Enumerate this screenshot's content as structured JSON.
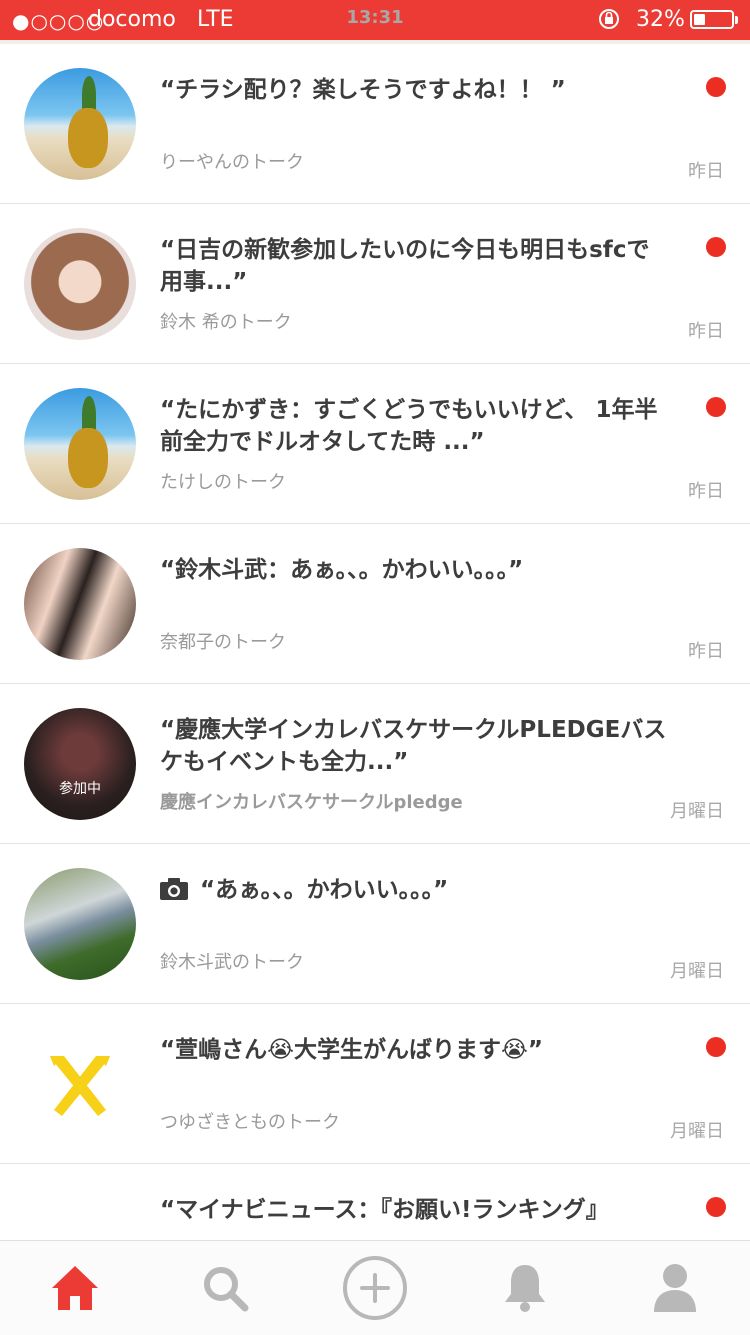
{
  "status_bar": {
    "signal": "●○○○○",
    "carrier": "docomo",
    "network": "LTE",
    "time": "13:31",
    "battery": "32%"
  },
  "feed": {
    "items": [
      {
        "title": "“チラシ配り？楽しそうですよね！！ ”",
        "subtitle": "りーやんのトーク",
        "time": "昨日",
        "unread": true
      },
      {
        "title": "“日吉の新歓参加したいのに今日も明日もsfcで用事...”",
        "subtitle": "鈴木 希のトーク",
        "time": "昨日",
        "unread": true
      },
      {
        "title": "“たにかずき：すごくどうでもいいけど、 1年半前全力でドルオタしてた時 ...”",
        "subtitle": "たけしのトーク",
        "time": "昨日",
        "unread": true
      },
      {
        "title": "“鈴木斗武：あぁ。、。かわいい。。。”",
        "subtitle": "奈都子のトーク",
        "time": "昨日",
        "unread": false
      },
      {
        "title": "“慶應大学インカレバスケサークルPLEDGEバスケもイベントも全力...”",
        "subtitle": "慶應インカレバスケサークルpledge",
        "time": "月曜日",
        "unread": false,
        "joined_label": "参加中"
      },
      {
        "title": "“あぁ。、。かわいい。。。”",
        "subtitle": "鈴木斗武のトーク",
        "time": "月曜日",
        "unread": false,
        "icon": "camera-icon"
      },
      {
        "title": "“萱嶋さん😭大学生がんばります😭”",
        "subtitle": "つゆざきとものトーク",
        "time": "月曜日",
        "unread": true
      },
      {
        "title": "“マイナビニュース：『お願い!ランキング』",
        "subtitle": "",
        "time": "",
        "unread": true
      }
    ]
  },
  "tab_bar": {
    "tabs": [
      {
        "icon": "home-icon",
        "active": true
      },
      {
        "icon": "search-icon",
        "active": false
      },
      {
        "icon": "add-icon",
        "active": false
      },
      {
        "icon": "bell-icon",
        "active": false
      },
      {
        "icon": "profile-icon",
        "active": false
      }
    ]
  },
  "colors": {
    "accent": "#ec3b35",
    "unread_dot": "#ec2d22",
    "inactive_icon": "#b8b8b8",
    "logo_yellow": "#f7d117"
  }
}
